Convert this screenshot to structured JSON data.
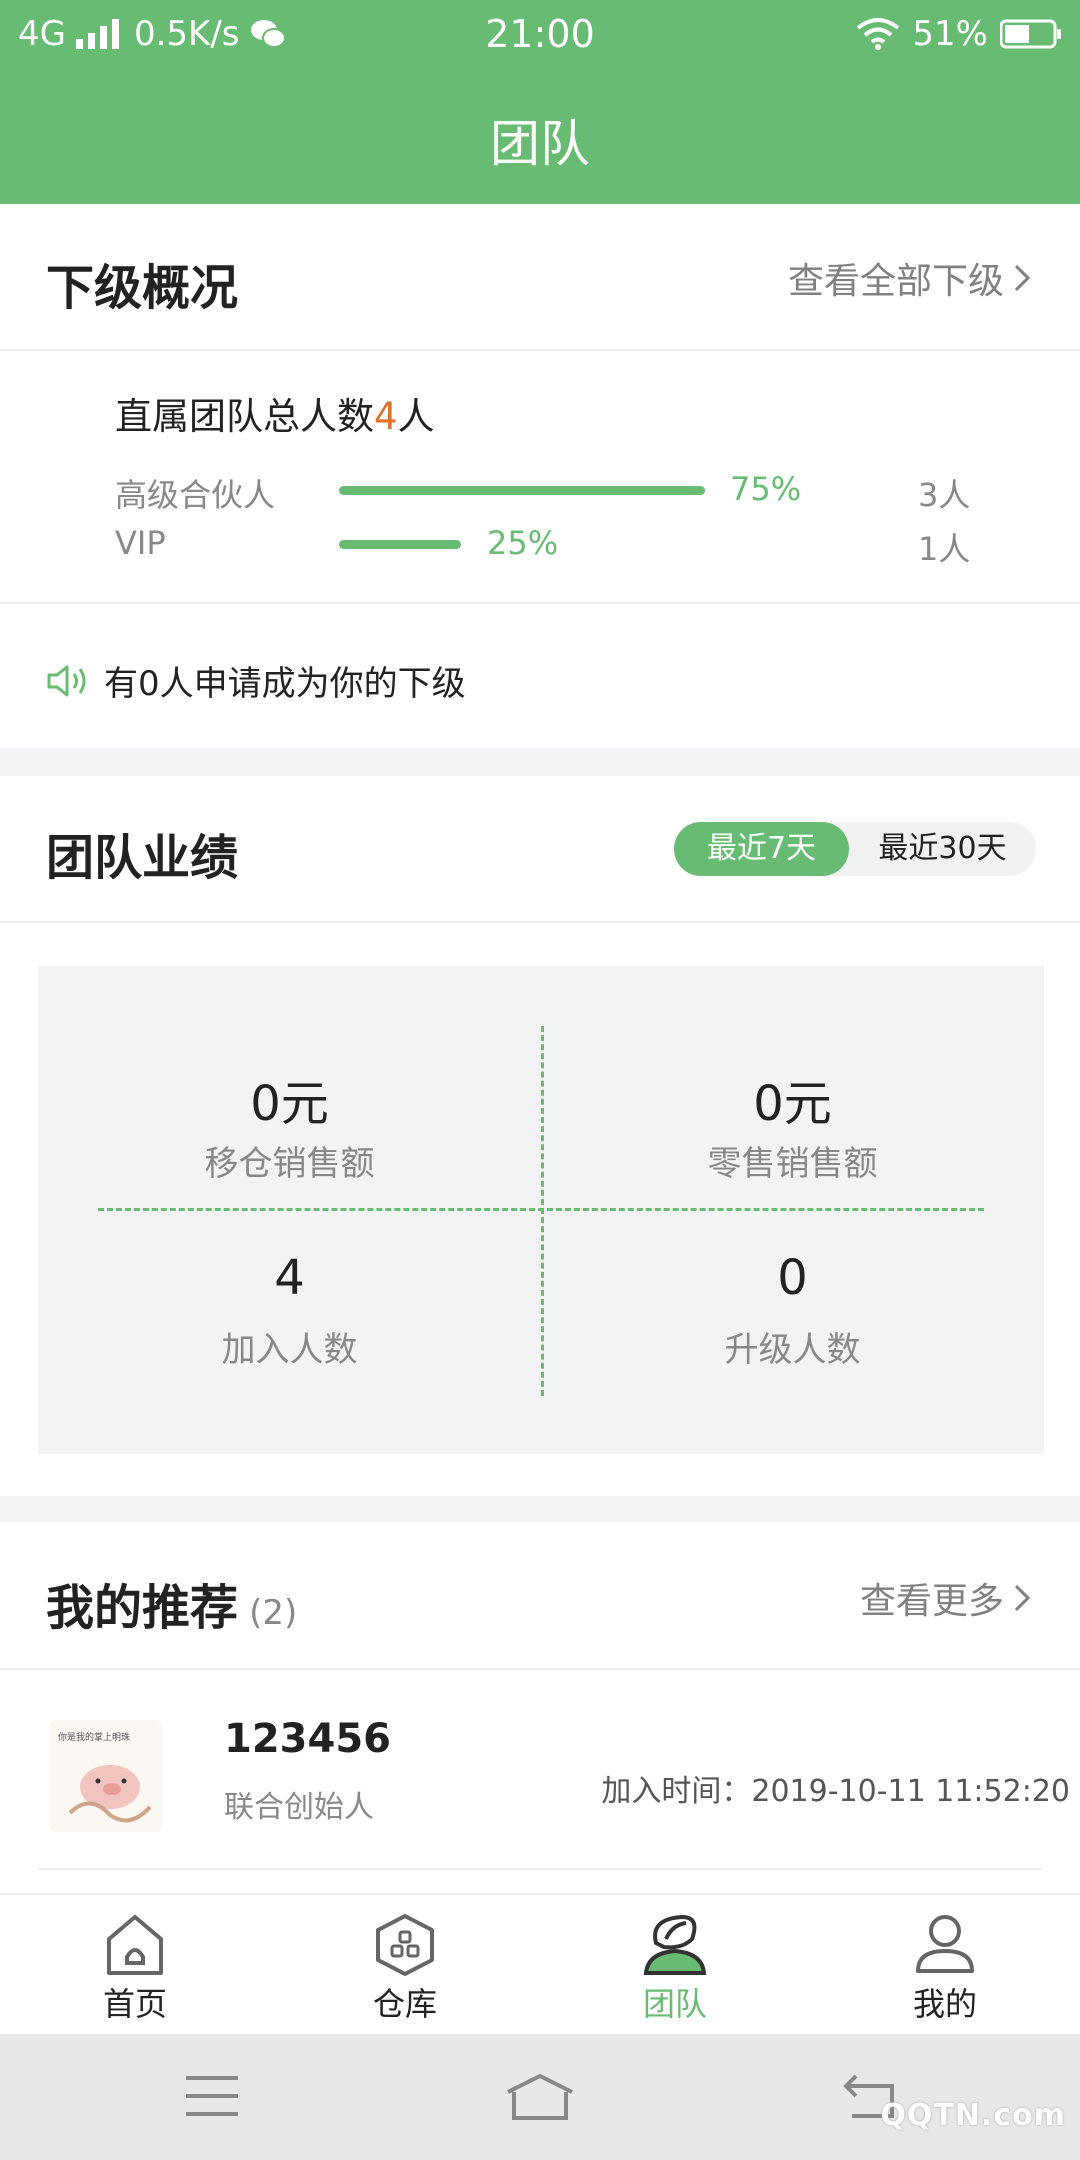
{
  "status_bar": {
    "network": "4G",
    "speed": "0.5K/s",
    "time": "21:00",
    "battery": "51%"
  },
  "header": {
    "title": "团队"
  },
  "subordinates": {
    "title": "下级概况",
    "view_all": "查看全部下级",
    "total_prefix": "直属团队总人数",
    "total_count": "4",
    "total_suffix": "人",
    "breakdown": [
      {
        "label": "高级合伙人",
        "percent": "75%",
        "count": "3人",
        "fraction": 0.75
      },
      {
        "label": "VIP",
        "percent": "25%",
        "count": "1人",
        "fraction": 0.25
      }
    ],
    "notice": "有0人申请成为你的下级"
  },
  "performance": {
    "title": "团队业绩",
    "tabs": [
      "最近7天",
      "最近30天"
    ],
    "active_tab": "最近7天",
    "stats": [
      {
        "value": "0元",
        "label": "移仓销售额"
      },
      {
        "value": "0元",
        "label": "零售销售额"
      },
      {
        "value": "4",
        "label": "加入人数"
      },
      {
        "value": "0",
        "label": "升级人数"
      }
    ]
  },
  "recommend": {
    "title": "我的推荐",
    "count": "(2)",
    "more": "查看更多",
    "items": [
      {
        "name": "123456",
        "role": "联合创始人",
        "join_time": "加入时间：2019-10-11 11:52:20",
        "avatar_text": "你是我的掌上明珠"
      }
    ]
  },
  "tabbar": {
    "items": [
      {
        "label": "首页",
        "icon": "home-icon"
      },
      {
        "label": "仓库",
        "icon": "warehouse-icon"
      },
      {
        "label": "团队",
        "icon": "team-icon"
      },
      {
        "label": "我的",
        "icon": "user-icon"
      }
    ],
    "active": "团队"
  },
  "watermark": "QQTN.com",
  "colors": {
    "accent": "#68bb72",
    "highlight": "#e0702a"
  }
}
